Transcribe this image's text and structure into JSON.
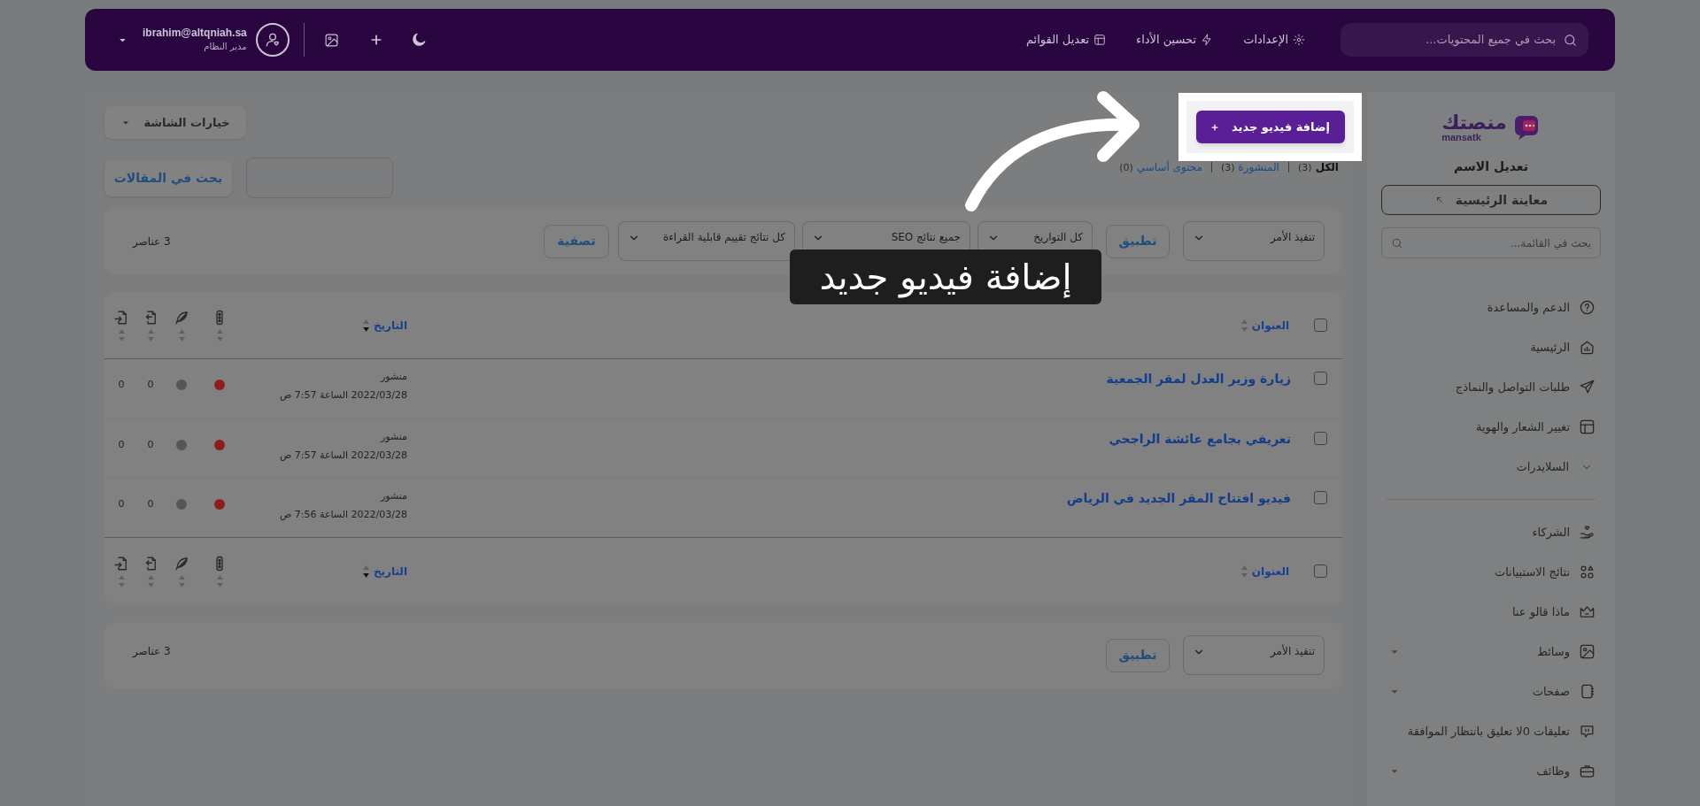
{
  "topbar": {
    "search_placeholder": "بحث في جميع المحتويات...",
    "nav": [
      {
        "label": "الإعدادات"
      },
      {
        "label": "تحسين الأداء"
      },
      {
        "label": "تعديل القوائم"
      }
    ],
    "user": {
      "email": "ibrahim@altqniah.sa",
      "role": "مدير النظام"
    }
  },
  "sidebar": {
    "logo": {
      "name": "منصتك",
      "latin": "mansatk"
    },
    "site_name": "تعديل الاسم",
    "preview_button": "معاينة الرئيسية",
    "search_placeholder": "بحث في القائمة...",
    "groups": [
      [
        {
          "label": "الدعم والمساعدة",
          "kind": "link"
        },
        {
          "label": "الرئيسية",
          "kind": "link"
        },
        {
          "label": "طلبات التواصل والنماذج",
          "kind": "link"
        },
        {
          "label": "تغيير الشعار والهوية",
          "kind": "link"
        },
        {
          "label": "السلايدرات",
          "kind": "collapsible"
        }
      ],
      [
        {
          "label": "الشركاء",
          "kind": "link"
        },
        {
          "label": "نتائج الاستبيانات",
          "kind": "link"
        },
        {
          "label": "ماذا قالو عنا",
          "kind": "link"
        },
        {
          "label": "وسائط",
          "kind": "dropdown"
        },
        {
          "label": "صفحات",
          "kind": "dropdown"
        },
        {
          "label": "تعليقات 0لا تعليق بانتظار الموافقة",
          "kind": "link"
        },
        {
          "label": "وظائف",
          "kind": "dropdown"
        }
      ]
    ]
  },
  "page": {
    "add_button": "إضافة فيديو جديد",
    "screen_options": "خيارات الشاشة",
    "status_links": [
      {
        "label": "الكل",
        "count": "(3)",
        "selected": true
      },
      {
        "label": "المنشورة",
        "count": "(3)",
        "selected": false
      },
      {
        "label": "محتوى أساسي",
        "count": "(0)",
        "selected": false
      }
    ],
    "search_button": "بحث في المقالات",
    "filters": {
      "bulk_action": "تنفيذ الأمر",
      "apply_button": "تطبيق",
      "selects": [
        "كل التواريخ",
        "جميع نتائج SEO",
        "كل نتائج تقييم قابلية القراءة"
      ],
      "filter_button": "تصفية",
      "item_count": "3 عناصر"
    },
    "table": {
      "select_all_checked": false,
      "columns": [
        {
          "label": "العنوان",
          "sorted_descending": false
        },
        {
          "label": "التاريخ",
          "sorted_descending": true
        }
      ],
      "rows": [
        {
          "title": "زيارة وزير العدل لمقر الجمعية",
          "checked": false,
          "status": "منشور",
          "date": "2022/03/28 الساعة 7:57 ص",
          "dots": [
            {
              "color": "#8e1c1c"
            },
            {
              "color": "#565656"
            }
          ],
          "counts": [
            "0",
            "0"
          ]
        },
        {
          "title": "تعريفي بجامع عائشة الراجحي",
          "checked": false,
          "status": "منشور",
          "date": "2022/03/28 الساعة 7:57 ص",
          "dots": [
            {
              "color": "#8e1c1c"
            },
            {
              "color": "#565656"
            }
          ],
          "counts": [
            "0",
            "0"
          ]
        },
        {
          "title": "فيديو افتتاح المقر الجديد في الرياض",
          "checked": false,
          "status": "منشور",
          "date": "2022/03/28 الساعة 7:56 ص",
          "dots": [
            {
              "color": "#8e1c1c"
            },
            {
              "color": "#565656"
            }
          ],
          "counts": [
            "0",
            "0"
          ]
        }
      ],
      "footer_select_all_checked": false,
      "footer_columns": [
        {
          "label": "العنوان",
          "sorted_descending": false
        },
        {
          "label": "التاريخ",
          "sorted_descending": true
        }
      ]
    },
    "bottom_bar": {
      "bulk_action": "تنفيذ الأمر",
      "apply_button": "تطبيق",
      "item_count": "3 عناصر"
    }
  },
  "tour": {
    "tooltip": "إضافة فيديو جديد"
  }
}
